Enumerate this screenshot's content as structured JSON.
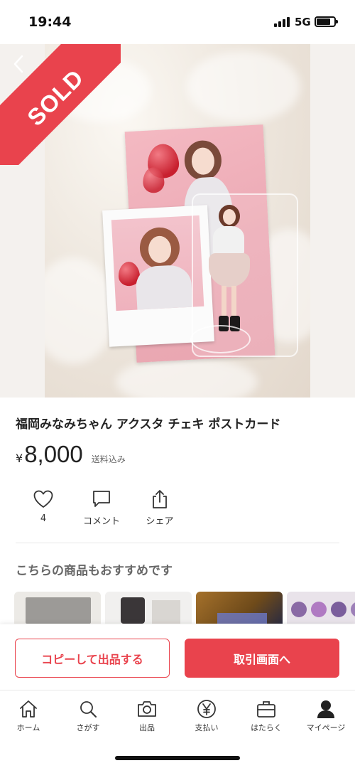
{
  "status_bar": {
    "time": "19:44",
    "network": "5G"
  },
  "hero": {
    "sold_label": "SOLD"
  },
  "product": {
    "title": "福岡みなみちゃん アクスタ チェキ ポストカード",
    "currency": "¥",
    "price": "8,000",
    "shipping": "送料込み"
  },
  "actions": {
    "like_count": "4",
    "comment_label": "コメント",
    "share_label": "シェア"
  },
  "recommend": {
    "title": "こちらの商品もおすすめです"
  },
  "action_bar": {
    "copy_label": "コピーして出品する",
    "trade_label": "取引画面へ"
  },
  "tab_bar": {
    "items": [
      {
        "label": "ホーム",
        "icon": "home-icon"
      },
      {
        "label": "さがす",
        "icon": "search-icon"
      },
      {
        "label": "出品",
        "icon": "camera-icon"
      },
      {
        "label": "支払い",
        "icon": "yen-icon"
      },
      {
        "label": "はたらく",
        "icon": "briefcase-icon"
      },
      {
        "label": "マイページ",
        "icon": "person-icon"
      }
    ]
  },
  "colors": {
    "accent": "#e9434d"
  }
}
